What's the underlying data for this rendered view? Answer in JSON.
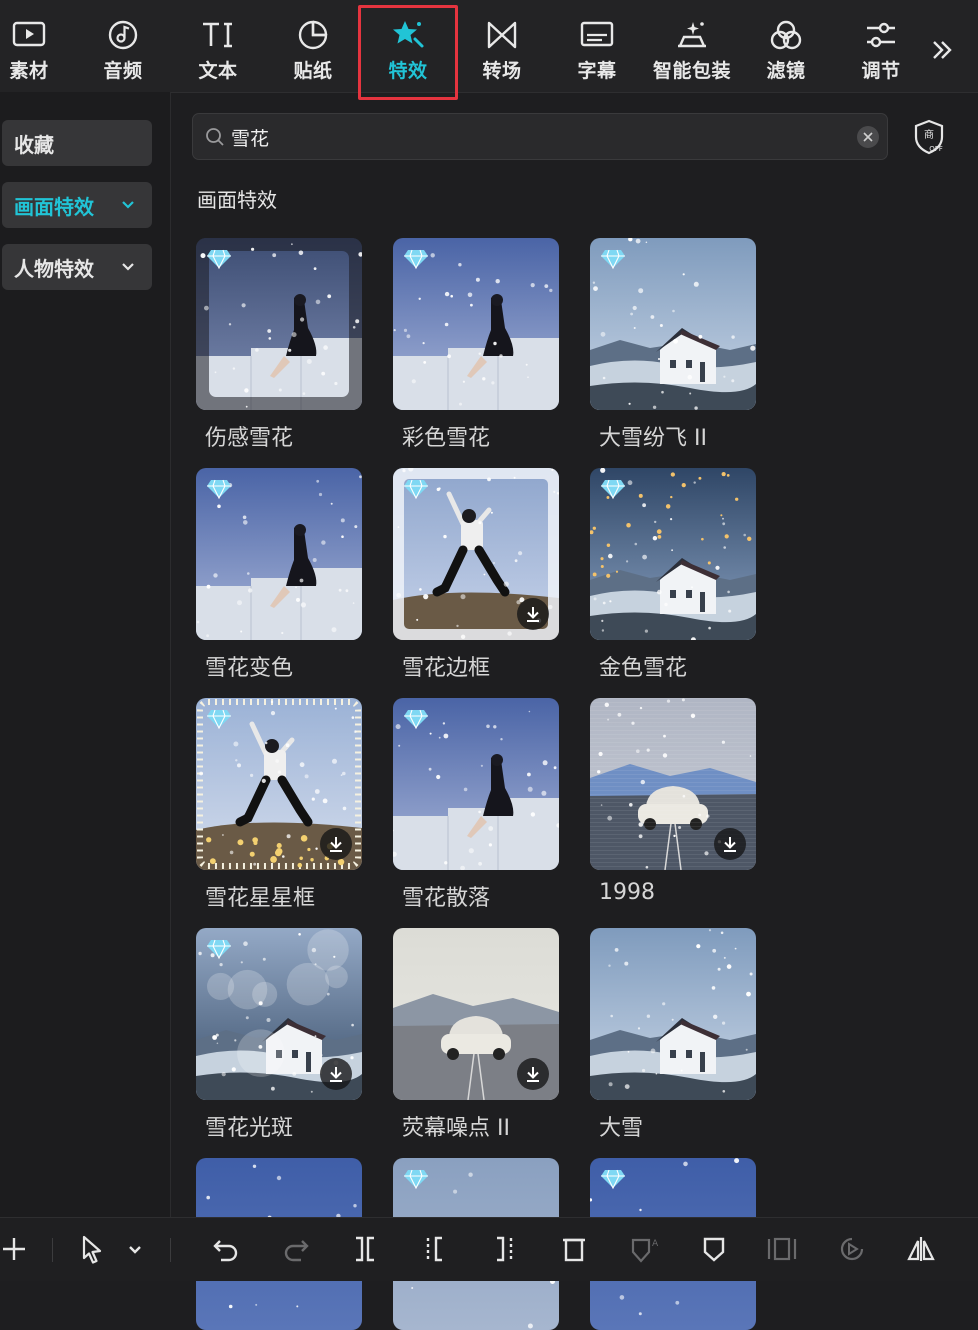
{
  "toolbar": {
    "tabs": [
      {
        "label": "素材",
        "icon": "media-icon"
      },
      {
        "label": "音频",
        "icon": "audio-icon"
      },
      {
        "label": "文本",
        "icon": "text-icon"
      },
      {
        "label": "贴纸",
        "icon": "sticker-icon"
      },
      {
        "label": "特效",
        "icon": "effects-icon"
      },
      {
        "label": "转场",
        "icon": "transition-icon"
      },
      {
        "label": "字幕",
        "icon": "caption-icon"
      },
      {
        "label": "智能包装",
        "icon": "smart-package-icon"
      },
      {
        "label": "滤镜",
        "icon": "filter-icon"
      },
      {
        "label": "调节",
        "icon": "adjust-icon"
      }
    ],
    "active_tab": "特效",
    "more_icon": "double-chevron-right-icon"
  },
  "sidebar": {
    "items": [
      {
        "label": "收藏"
      },
      {
        "label": "画面特效"
      },
      {
        "label": "人物特效"
      }
    ],
    "active_item": "画面特效"
  },
  "search": {
    "value": "雪花",
    "placeholder": ""
  },
  "section": {
    "title": "画面特效"
  },
  "effects": [
    {
      "label": "伤感雪花",
      "premium": true,
      "download": false,
      "scene": "woman-stairs-dark"
    },
    {
      "label": "彩色雪花",
      "premium": true,
      "download": false,
      "scene": "woman-stairs"
    },
    {
      "label": "大雪纷飞 II",
      "premium": true,
      "download": false,
      "scene": "house-snow"
    },
    {
      "label": "雪花变色",
      "premium": true,
      "download": false,
      "scene": "woman-stairs"
    },
    {
      "label": "雪花边框",
      "premium": true,
      "download": true,
      "scene": "man-jump-frost"
    },
    {
      "label": "金色雪花",
      "premium": true,
      "download": false,
      "scene": "house-gold"
    },
    {
      "label": "雪花星星框",
      "premium": true,
      "download": true,
      "scene": "man-jump-stars"
    },
    {
      "label": "雪花散落",
      "premium": true,
      "download": false,
      "scene": "woman-stairs"
    },
    {
      "label": "1998",
      "premium": false,
      "download": true,
      "scene": "car-retro"
    },
    {
      "label": "雪花光斑",
      "premium": true,
      "download": true,
      "scene": "house-bokeh"
    },
    {
      "label": "荧幕噪点 II",
      "premium": false,
      "download": true,
      "scene": "car-light"
    },
    {
      "label": "大雪",
      "premium": false,
      "download": false,
      "scene": "house-snow"
    },
    {
      "label": "",
      "premium": false,
      "download": false,
      "scene": "partial-snow"
    },
    {
      "label": "",
      "premium": true,
      "download": false,
      "scene": "partial-sky"
    },
    {
      "label": "",
      "premium": true,
      "download": false,
      "scene": "partial-snow"
    }
  ],
  "bottom_toolbar": {
    "icons": [
      "add-icon",
      "select-cursor-icon",
      "dropdown-chevron-icon",
      "undo-icon",
      "redo-icon",
      "split-icon",
      "split-left-icon",
      "split-right-icon",
      "delete-icon",
      "ai-shield-icon",
      "shield-icon",
      "freeze-frame-icon",
      "play-circle-icon",
      "mirror-icon"
    ]
  },
  "colors": {
    "accent": "#21c4d6",
    "highlight_frame": "#e5343f",
    "background": "#1e1e20",
    "panel": "#363638"
  }
}
